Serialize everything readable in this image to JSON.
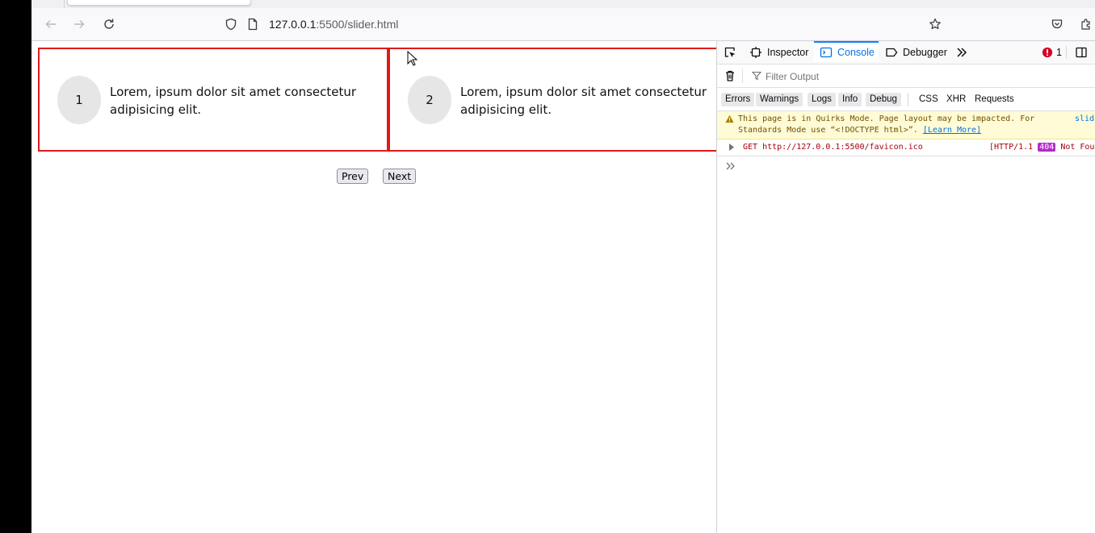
{
  "browser": {
    "url_host": "127.0.0.1",
    "url_rest": ":5500/slider.html"
  },
  "page": {
    "slides": [
      {
        "number": "1",
        "text": "Lorem, ipsum dolor sit amet consectetur adipisicing elit."
      },
      {
        "number": "2",
        "text": "Lorem, ipsum dolor sit amet consectetur adipisicing elit."
      }
    ],
    "prev_label": "Prev",
    "next_label": "Next"
  },
  "devtools": {
    "tabs": {
      "inspector": "Inspector",
      "console": "Console",
      "debugger": "Debugger"
    },
    "error_count": "1",
    "filter_placeholder": "Filter Output",
    "levels": [
      "Errors",
      "Warnings",
      "Logs",
      "Info",
      "Debug"
    ],
    "categories": [
      "CSS",
      "XHR",
      "Requests"
    ],
    "warning": {
      "line1": "This page is in Quirks Mode. Page layout may be impacted. For",
      "line2_prefix": "Standards Mode use “<!DOCTYPE html>”.",
      "link": "[Learn More]",
      "source": "slid"
    },
    "error": {
      "request": "GET http://127.0.0.1:5500/favicon.ico",
      "status_prefix": "[HTTP/1.1",
      "status_code": "404",
      "status_suffix": "Not Fou"
    }
  },
  "colors": {
    "slide_border": "#e0191b",
    "console_active": "#0074e8",
    "error_badge": "#d70022",
    "status_badge": "#b32cc9"
  }
}
